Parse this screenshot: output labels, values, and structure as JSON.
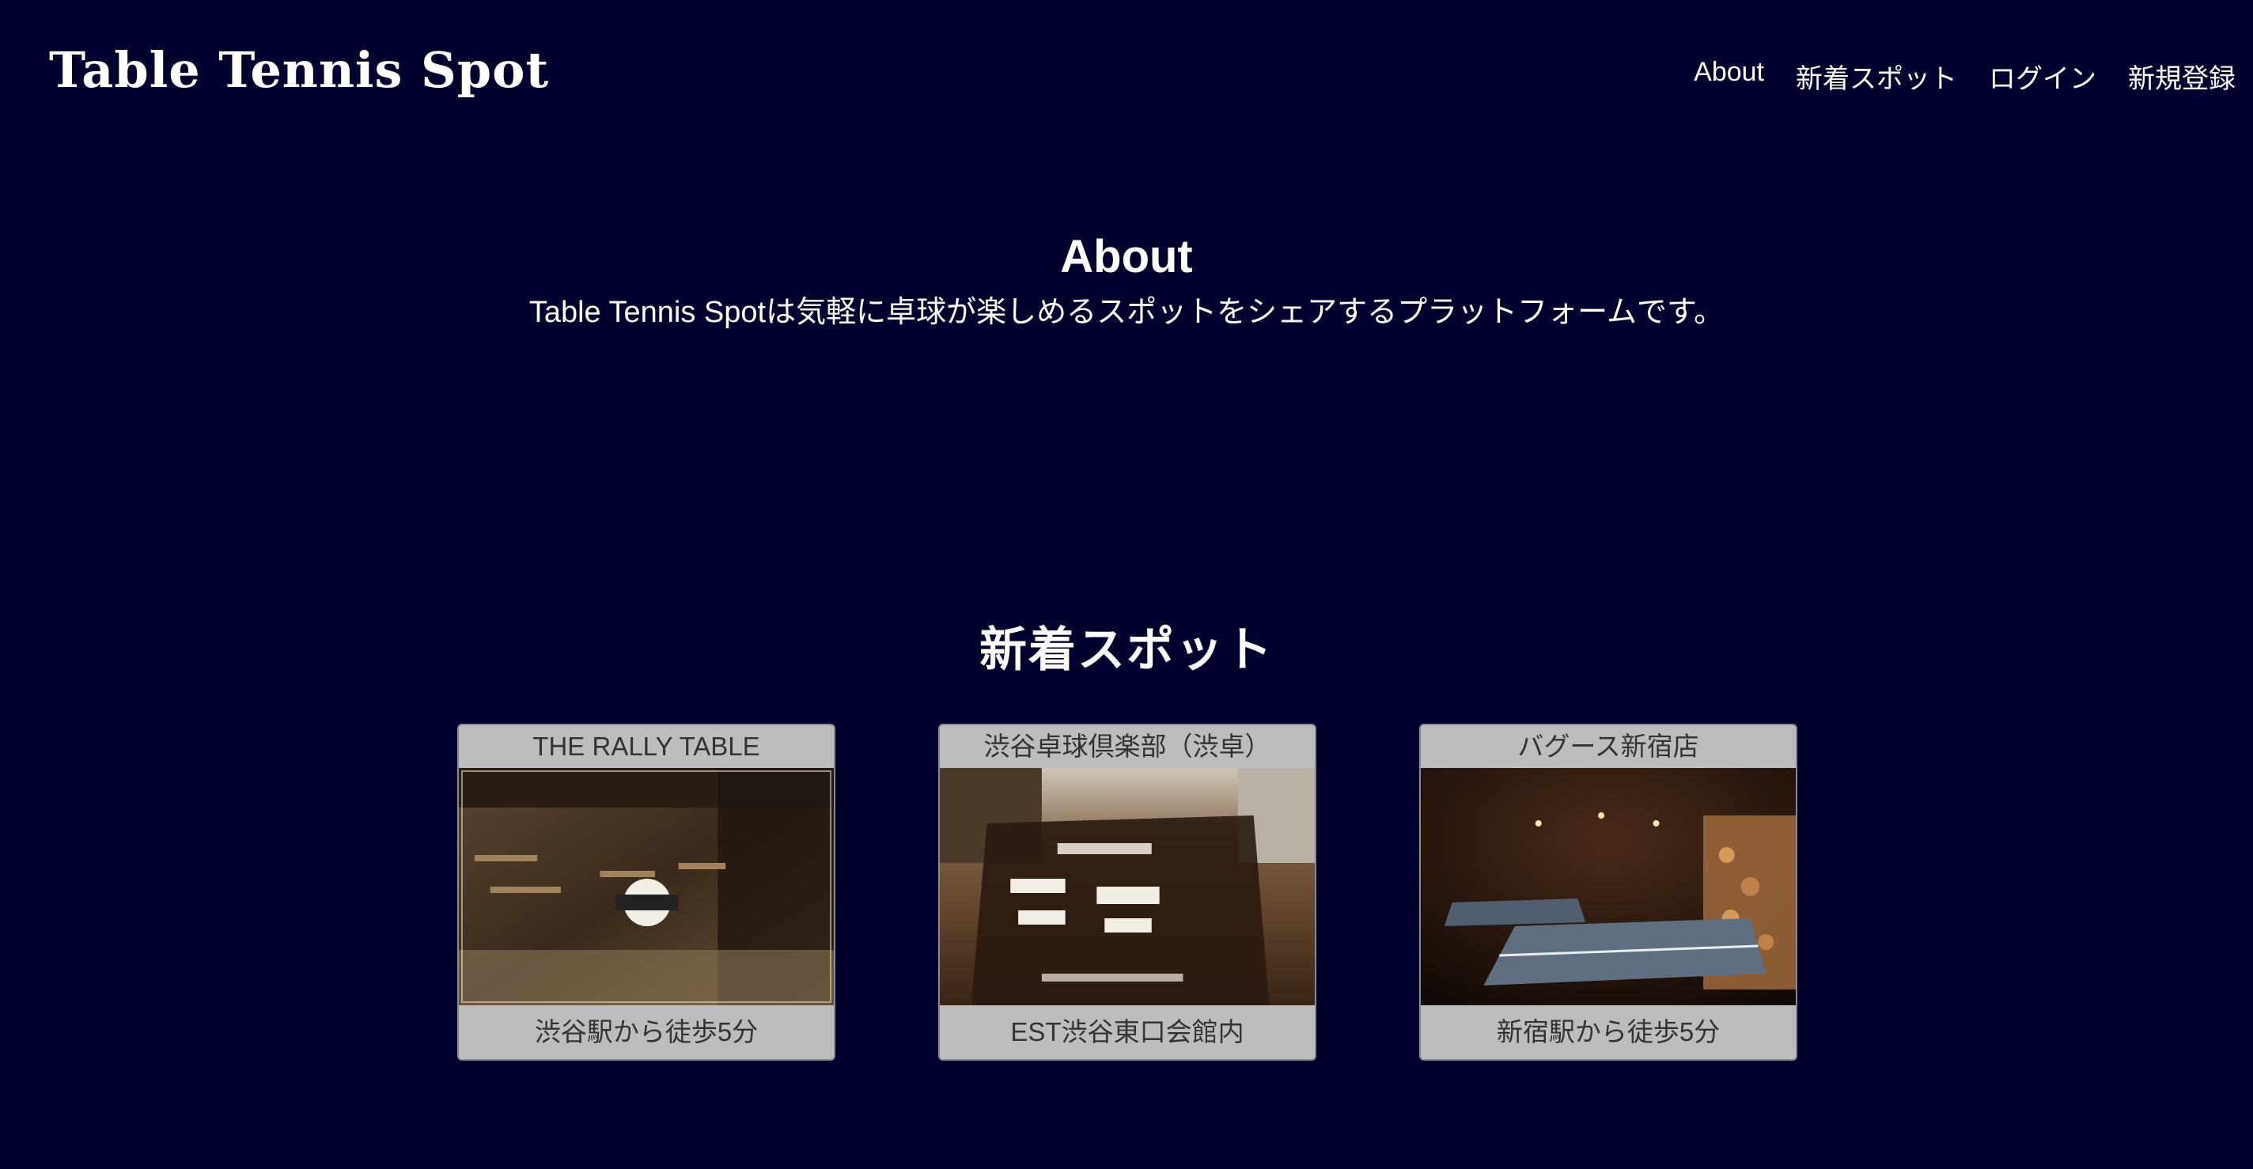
{
  "header": {
    "logo": "Table Tennis Spot",
    "nav": [
      "About",
      "新着スポット",
      "ログイン",
      "新規登録"
    ]
  },
  "about": {
    "title": "About",
    "description": "Table Tennis Spotは気軽に卓球が楽しめるスポットをシェアするプラットフォームです。"
  },
  "spots": {
    "title": "新着スポット",
    "items": [
      {
        "name": "THE RALLY TABLE",
        "access": "渋谷駅から徒歩5分"
      },
      {
        "name": "渋谷卓球倶楽部（渋卓）",
        "access": "EST渋谷東口会館内"
      },
      {
        "name": "バグース新宿店",
        "access": "新宿駅から徒歩5分"
      }
    ]
  },
  "colors": {
    "background": "#00002f",
    "card_bg": "#bdbdbd",
    "card_text": "#333333"
  }
}
